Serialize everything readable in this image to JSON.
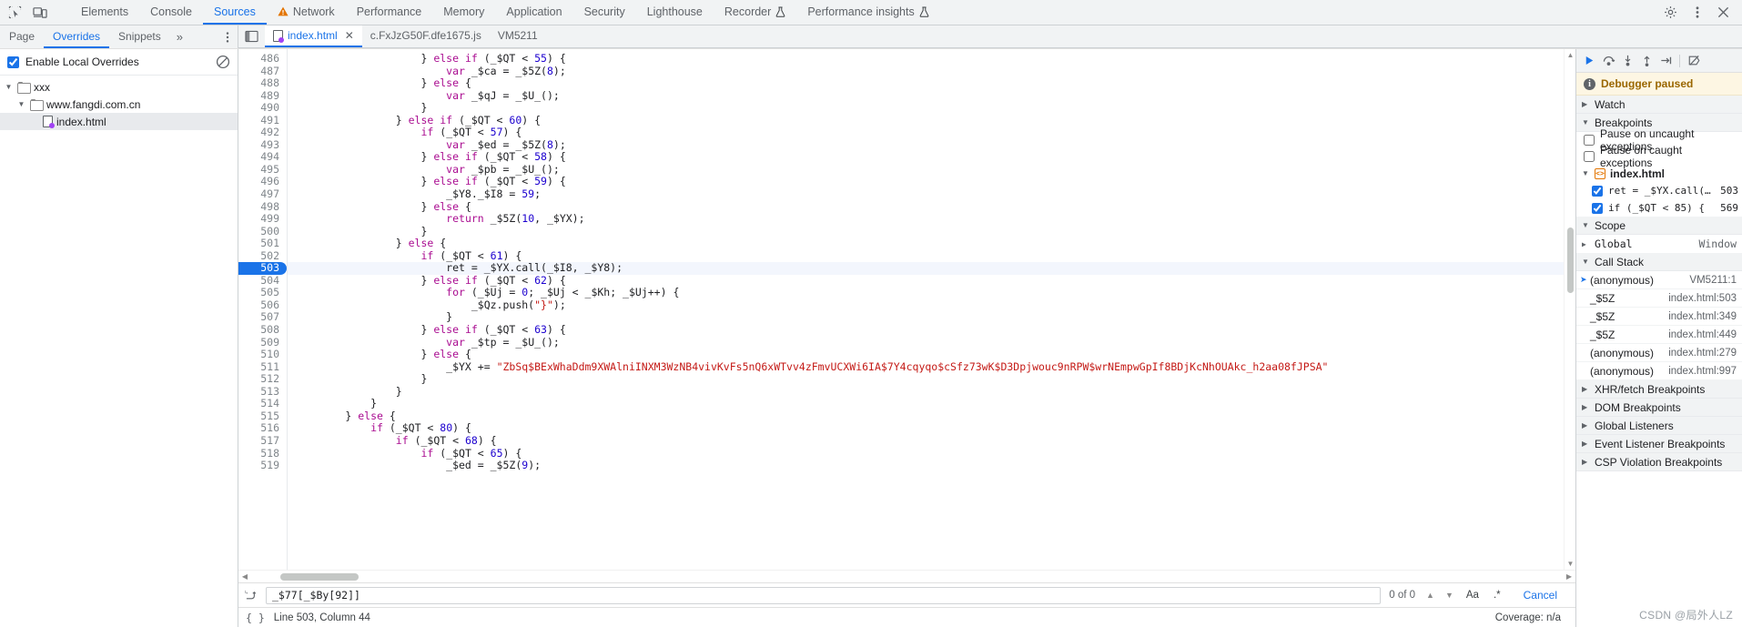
{
  "main_tabs": [
    {
      "label": "Elements",
      "active": false,
      "warn": false
    },
    {
      "label": "Console",
      "active": false,
      "warn": false
    },
    {
      "label": "Sources",
      "active": true,
      "warn": false
    },
    {
      "label": "Network",
      "active": false,
      "warn": true
    },
    {
      "label": "Performance",
      "active": false,
      "warn": false
    },
    {
      "label": "Memory",
      "active": false,
      "warn": false
    },
    {
      "label": "Application",
      "active": false,
      "warn": false
    },
    {
      "label": "Security",
      "active": false,
      "warn": false
    },
    {
      "label": "Lighthouse",
      "active": false,
      "warn": false
    },
    {
      "label": "Recorder",
      "active": false,
      "warn": false,
      "flask": true
    },
    {
      "label": "Performance insights",
      "active": false,
      "warn": false,
      "flask": true
    }
  ],
  "toolbar_icons": {
    "inspect": "inspect-element-icon",
    "device": "device-toolbar-icon",
    "settings": "gear-icon",
    "more": "more-vertical-icon",
    "close": "close-icon"
  },
  "navigator": {
    "tabs": [
      {
        "label": "Page",
        "active": false
      },
      {
        "label": "Overrides",
        "active": true
      },
      {
        "label": "Snippets",
        "active": false
      }
    ],
    "more_label": "»",
    "overrides_checkbox_label": "Enable Local Overrides",
    "overrides_checked": true,
    "tree": [
      {
        "label": "xxx",
        "depth": 0,
        "type": "folder",
        "expanded": true,
        "selected": false
      },
      {
        "label": "www.fangdi.com.cn",
        "depth": 1,
        "type": "folder",
        "expanded": true,
        "selected": false
      },
      {
        "label": "index.html",
        "depth": 2,
        "type": "file",
        "expanded": false,
        "selected": true
      }
    ]
  },
  "editor_tabs": [
    {
      "label": "index.html",
      "active": true,
      "closable": true,
      "icon": "html-file-icon"
    },
    {
      "label": "c.FxJzG50F.dfe1675.js",
      "active": false,
      "closable": false,
      "icon": "js-file-icon"
    },
    {
      "label": "VM5211",
      "active": false,
      "closable": false,
      "icon": "vm-file-icon"
    }
  ],
  "code": {
    "first_line": 486,
    "highlighted_line": 503,
    "lines": [
      {
        "n": 486,
        "text": "                    } else if (_$QT < 55) {"
      },
      {
        "n": 487,
        "text": "                        var _$ca = _$5Z(8);"
      },
      {
        "n": 488,
        "text": "                    } else {"
      },
      {
        "n": 489,
        "text": "                        var _$qJ = _$U_();"
      },
      {
        "n": 490,
        "text": "                    }"
      },
      {
        "n": 491,
        "text": "                } else if (_$QT < 60) {"
      },
      {
        "n": 492,
        "text": "                    if (_$QT < 57) {"
      },
      {
        "n": 493,
        "text": "                        var _$ed = _$5Z(8);"
      },
      {
        "n": 494,
        "text": "                    } else if (_$QT < 58) {"
      },
      {
        "n": 495,
        "text": "                        var _$pb = _$U_();"
      },
      {
        "n": 496,
        "text": "                    } else if (_$QT < 59) {"
      },
      {
        "n": 497,
        "text": "                        _$Y8._$I8 = 59;"
      },
      {
        "n": 498,
        "text": "                    } else {"
      },
      {
        "n": 499,
        "text": "                        return _$5Z(10, _$YX);"
      },
      {
        "n": 500,
        "text": "                    }"
      },
      {
        "n": 501,
        "text": "                } else {"
      },
      {
        "n": 502,
        "text": "                    if (_$QT < 61) {"
      },
      {
        "n": 503,
        "text": "                        ret = _$YX.call(_$I8, _$Y8);"
      },
      {
        "n": 504,
        "text": "                    } else if (_$QT < 62) {"
      },
      {
        "n": 505,
        "text": "                        for (_$Uj = 0; _$Uj < _$Kh; _$Uj++) {"
      },
      {
        "n": 506,
        "text": "                            _$Qz.push(\"}\");"
      },
      {
        "n": 507,
        "text": "                        }"
      },
      {
        "n": 508,
        "text": "                    } else if (_$QT < 63) {"
      },
      {
        "n": 509,
        "text": "                        var _$tp = _$U_();"
      },
      {
        "n": 510,
        "text": "                    } else {"
      },
      {
        "n": 511,
        "text": "                        _$YX += \"ZbSq$BExWhaDdm9XWAlniINXM3WzNB4vivKvFs5nQ6xWTvv4zFmvUCXWi6IA$7Y4cqyqo$cSfz73wK$D3Dpjwouc9nRPW$wrNEmpwGpIf8BDjKcNhOUAkc_h2aa08fJPSA\""
      },
      {
        "n": 512,
        "text": "                    }"
      },
      {
        "n": 513,
        "text": "                }"
      },
      {
        "n": 514,
        "text": "            }"
      },
      {
        "n": 515,
        "text": "        } else {"
      },
      {
        "n": 516,
        "text": "            if (_$QT < 80) {"
      },
      {
        "n": 517,
        "text": "                if (_$QT < 68) {"
      },
      {
        "n": 518,
        "text": "                    if (_$QT < 65) {"
      },
      {
        "n": 519,
        "text": "                        _$ed = _$5Z(9);"
      }
    ]
  },
  "search": {
    "value": "_$77[_$By[92]]",
    "placeholder": "Find",
    "result_count": "0 of 0",
    "match_case_label": "Aa",
    "regex_label": ".*",
    "cancel_label": "Cancel",
    "prev_icon": "chevron-up-icon",
    "next_icon": "chevron-down-icon",
    "replace_icon": "replace-toggle-icon"
  },
  "status": {
    "braces_icon": "{ }",
    "position": "Line 503, Column 44",
    "coverage": "Coverage: n/a"
  },
  "debugger": {
    "toolbar": [
      {
        "name": "resume-button",
        "icon": "resume-script-icon"
      },
      {
        "name": "step-over-button",
        "icon": "step-over-icon"
      },
      {
        "name": "step-into-button",
        "icon": "step-into-icon"
      },
      {
        "name": "step-out-button",
        "icon": "step-out-icon"
      },
      {
        "name": "step-button",
        "icon": "step-icon"
      },
      {
        "name": "deactivate-breakpoints-button",
        "icon": "deactivate-breakpoints-icon"
      }
    ],
    "paused_message": "Debugger paused",
    "watch": {
      "label": "Watch",
      "expanded": false
    },
    "breakpoints": {
      "label": "Breakpoints",
      "expanded": true,
      "pause_uncaught": {
        "label": "Pause on uncaught exceptions",
        "checked": false
      },
      "pause_caught": {
        "label": "Pause on caught exceptions",
        "checked": false
      },
      "file": "index.html",
      "items": [
        {
          "text": "ret = _$YX.call(_$I…",
          "line": "503",
          "checked": true
        },
        {
          "text": "if (_$QT < 85) {",
          "line": "569",
          "checked": true
        }
      ]
    },
    "scope": {
      "label": "Scope",
      "expanded": true,
      "entries": [
        {
          "name": "Global",
          "value": "Window",
          "expanded": false
        }
      ]
    },
    "call_stack": {
      "label": "Call Stack",
      "expanded": true,
      "frames": [
        {
          "name": "(anonymous)",
          "location": "VM5211:1",
          "current": true
        },
        {
          "name": "_$5Z",
          "location": "index.html:503",
          "current": false
        },
        {
          "name": "_$5Z",
          "location": "index.html:349",
          "current": false
        },
        {
          "name": "_$5Z",
          "location": "index.html:449",
          "current": false
        },
        {
          "name": "(anonymous)",
          "location": "index.html:279",
          "current": false
        },
        {
          "name": "(anonymous)",
          "location": "index.html:997",
          "current": false
        }
      ]
    },
    "categories": [
      {
        "label": "XHR/fetch Breakpoints",
        "expanded": false
      },
      {
        "label": "DOM Breakpoints",
        "expanded": false
      },
      {
        "label": "Global Listeners",
        "expanded": false
      },
      {
        "label": "Event Listener Breakpoints",
        "expanded": false
      },
      {
        "label": "CSP Violation Breakpoints",
        "expanded": false
      }
    ]
  },
  "watermark": "CSDN @局外人LZ",
  "colors": {
    "accent": "#1a73e8",
    "warn": "#e37400",
    "paused_bg": "#fdf6e3",
    "paused_text": "#9a6700",
    "toolbar_bg": "#f1f3f4"
  }
}
